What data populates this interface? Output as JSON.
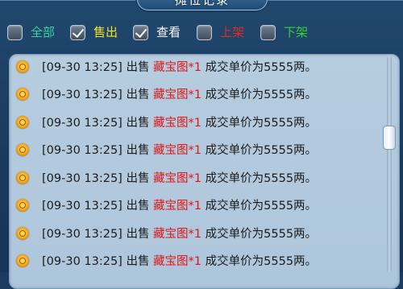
{
  "window": {
    "title": "摊位记录"
  },
  "filters": [
    {
      "label": "全部",
      "checked": false,
      "color": "#34d3a0"
    },
    {
      "label": "售出",
      "checked": true,
      "color": "#f5e31b"
    },
    {
      "label": "查看",
      "checked": true,
      "color": "#ffffff"
    },
    {
      "label": "上架",
      "checked": false,
      "color": "#e52a20"
    },
    {
      "label": "下架",
      "checked": false,
      "color": "#33d23a"
    }
  ],
  "records": [
    {
      "time": "[09-30 13:25]",
      "action": "出售",
      "item": "藏宝图*1",
      "result": "成交单价为5555两。"
    },
    {
      "time": "[09-30 13:25]",
      "action": "出售",
      "item": "藏宝图*1",
      "result": "成交单价为5555两。"
    },
    {
      "time": "[09-30 13:25]",
      "action": "出售",
      "item": "藏宝图*1",
      "result": "成交单价为5555两。"
    },
    {
      "time": "[09-30 13:25]",
      "action": "出售",
      "item": "藏宝图*1",
      "result": "成交单价为5555两。"
    },
    {
      "time": "[09-30 13:25]",
      "action": "出售",
      "item": "藏宝图*1",
      "result": "成交单价为5555两。"
    },
    {
      "time": "[09-30 13:25]",
      "action": "出售",
      "item": "藏宝图*1",
      "result": "成交单价为5555两。"
    },
    {
      "time": "[09-30 13:25]",
      "action": "出售",
      "item": "藏宝图*1",
      "result": "成交单价为5555两。"
    },
    {
      "time": "[09-30 13:25]",
      "action": "出售",
      "item": "藏宝图*1",
      "result": "成交单价为5555两。"
    }
  ],
  "colors": {
    "item_highlight": "#e01515",
    "panel_bg": "#b2c9de",
    "frame_bg": "#1f4368"
  }
}
